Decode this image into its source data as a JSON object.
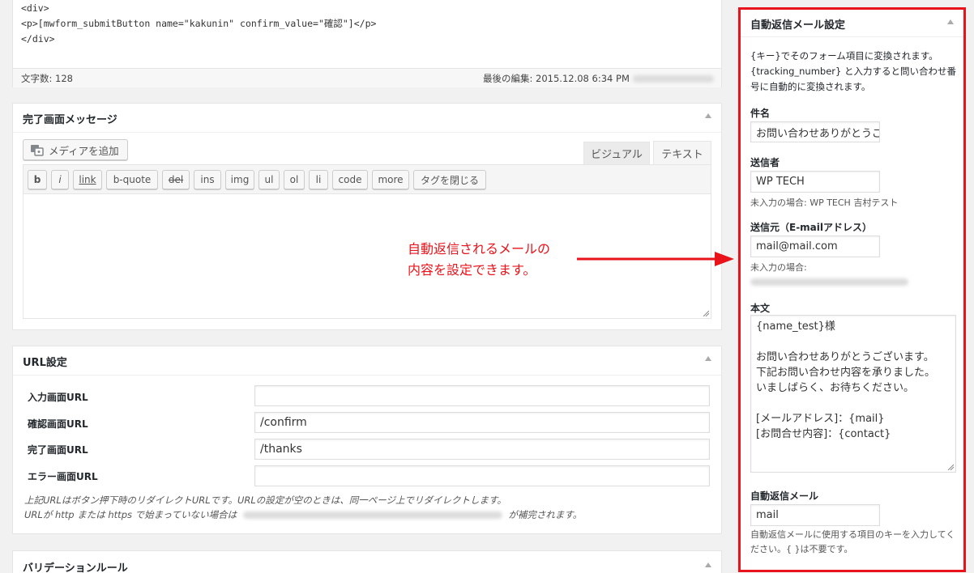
{
  "code_editor": {
    "lines": [
      "<div>",
      "<p>[mwform_submitButton name=\"kakunin\" confirm_value=\"確認\"]</p>",
      "</div>"
    ],
    "word_count": "文字数: 128",
    "last_edit": "最後の編集: 2015.12.08 6:34 PM"
  },
  "complete_message": {
    "title": "完了画面メッセージ",
    "add_media": "メディアを追加",
    "tab_visual": "ビジュアル",
    "tab_text": "テキスト",
    "quicktags": [
      "b",
      "i",
      "link",
      "b-quote",
      "del",
      "ins",
      "img",
      "ul",
      "ol",
      "li",
      "code",
      "more",
      "タグを閉じる"
    ]
  },
  "annotation": {
    "line1": "自動返信されるメールの",
    "line2": "内容を設定できます。",
    "color": "#e8131b"
  },
  "url_settings": {
    "title": "URL設定",
    "rows": [
      {
        "label": "入力画面URL",
        "value": ""
      },
      {
        "label": "確認画面URL",
        "value": "/confirm"
      },
      {
        "label": "完了画面URL",
        "value": "/thanks"
      },
      {
        "label": "エラー画面URL",
        "value": ""
      }
    ],
    "note1": "上記URLはボタン押下時のリダイレクトURLです。URLの設定が空のときは、同一ページ上でリダイレクトします。",
    "note2a": "URLが http または https で始まっていない場合は",
    "note2b": "が補完されます。"
  },
  "validation": {
    "title": "バリデーションルール"
  },
  "autoreply": {
    "title": "自動返信メール設定",
    "description": "{キー}でそのフォーム項目に変換されます。{tracking_number} と入力すると問い合わせ番号に自動的に変換されます。",
    "subject_label": "件名",
    "subject_value": "お問い合わせありがとうございます",
    "sender_label": "送信者",
    "sender_value": "WP TECH",
    "sender_note": "未入力の場合: WP TECH 吉村テスト",
    "from_label": "送信元（E-mailアドレス）",
    "from_value": "mail@mail.com",
    "from_note": "未入力の場合:",
    "body_label": "本文",
    "body_lines": [
      "{name_test}様",
      "",
      "お問い合わせありがとうございます。",
      "下記お問い合わせ内容を承りました。",
      "いましばらく、お待ちください。",
      "",
      "[メールアドレス]：{mail}",
      "[お問合せ内容]：{contact}"
    ],
    "autoreply_label": "自動返信メール",
    "autoreply_value": "mail",
    "autoreply_note": "自動返信メールに使用する項目のキーを入力してください。{ }は不要です。",
    "highlight_color": "#e8131b"
  }
}
